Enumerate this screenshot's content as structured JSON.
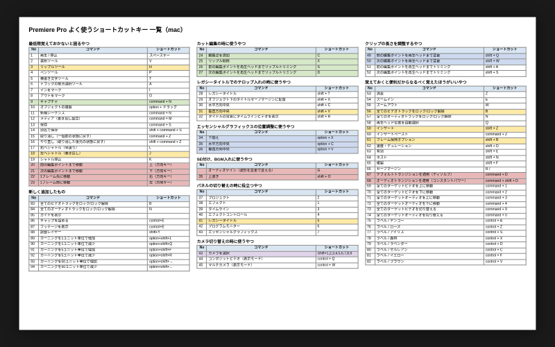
{
  "doc_title": "Premiere Pro よく使うショートカットキー 一覧（mac）",
  "headers": {
    "no": "No",
    "cmd": "コマンド",
    "key": "ショートカット"
  },
  "col1": {
    "sec_a": "最低限覚えておかないと困るやつ",
    "rows_a": [
      {
        "n": 1,
        "c": "再生 / 停止",
        "k": "スペースキー"
      },
      {
        "n": 2,
        "c": "選択ツール",
        "k": "V"
      },
      {
        "n": 3,
        "c": "リップルツール",
        "k": "H",
        "hl": "y"
      },
      {
        "n": 4,
        "c": "ペンツール",
        "k": "P"
      },
      {
        "n": 5,
        "c": "横書き文字ツール",
        "k": "T"
      },
      {
        "n": 6,
        "c": "トラックの前方選択ツール",
        "k": "A"
      },
      {
        "n": 7,
        "c": "インをマーク",
        "k": "I"
      },
      {
        "n": 8,
        "c": "アウトをマーク",
        "k": "O"
      },
      {
        "n": 9,
        "c": "キャプチャ",
        "k": "command + N",
        "hl": "g"
      },
      {
        "n": 10,
        "c": "オブジェクトの複製",
        "k": "option + ドラッグ"
      },
      {
        "n": 11,
        "c": "新規シーケンス",
        "k": "command + N"
      },
      {
        "n": 12,
        "c": "メディア（書き出し設定）",
        "k": "command + M"
      },
      {
        "n": 13,
        "c": "保存",
        "k": "command + S"
      },
      {
        "n": 14,
        "c": "別名で保存",
        "k": "shift + command + S"
      },
      {
        "n": 15,
        "c": "取り消し（一個前の状態に戻す）",
        "k": "command + Z"
      },
      {
        "n": 16,
        "c": "やり直し（取り消した後元の状態に戻す）",
        "k": "shift + command + Z"
      },
      {
        "n": 17,
        "c": "右へシャトル（早送り）",
        "k": "L"
      },
      {
        "n": 18,
        "c": "左へシャトル（巻き戻し）",
        "k": "J",
        "hl": "y"
      },
      {
        "n": 19,
        "c": "シャトル停止",
        "k": "K"
      },
      {
        "n": 20,
        "c": "前の編集ポイントまで移動",
        "k": "上（方向キー）",
        "hl": "r"
      },
      {
        "n": 21,
        "c": "次の編集ポイントまで移動",
        "k": "下（方向キー）",
        "hl": "r"
      },
      {
        "n": 22,
        "c": "1フレーム先に移動",
        "k": "右（方向キー）",
        "hl": "r"
      },
      {
        "n": 23,
        "c": "1フレーム前に移動",
        "k": "左（方向キー）",
        "hl": "r"
      }
    ],
    "sec_b": "新しく追加したもの",
    "rows_b": [
      {
        "n": 83,
        "c": "全てのビデオトラックをロック/ロック解除",
        "k": "B"
      },
      {
        "n": 84,
        "c": "全てのオーディオトラックをロック/ロック解除",
        "k": "N"
      },
      {
        "n": 85,
        "c": "ガイドを表示",
        "k": ""
      },
      {
        "n": 86,
        "c": "ギャップを詰める",
        "k": "control+E"
      },
      {
        "n": 87,
        "c": "フッテージを表示",
        "k": "control+E"
      },
      {
        "n": 88,
        "c": "調整レイヤー",
        "k": "shift+Y"
      },
      {
        "n": 89,
        "c": "カーニングを1ユニット単位で増加",
        "k": "option+shift+1"
      },
      {
        "n": 90,
        "c": "カーニングを1ユニット単位で減少",
        "k": "option+shift+Q"
      },
      {
        "n": 91,
        "c": "カーニングを5ユニット単位で増加",
        "k": "option+shift+F"
      },
      {
        "n": 92,
        "c": "カーニングを5ユニット単位で減少",
        "k": "option+shift+R"
      },
      {
        "n": 93,
        "c": "カーニングを50ユニット単位で増加",
        "k": "option+shift+→"
      },
      {
        "n": 94,
        "c": "カーニングを50ユニット単位で減少",
        "k": "option+shift+←"
      }
    ]
  },
  "col2": {
    "sec_a": "カット編集の時に使うやつ",
    "rows_a": [
      {
        "n": 24,
        "c": "編集点を追加",
        "k": "C",
        "hl": "g"
      },
      {
        "n": 25,
        "c": "リップル削除",
        "k": "X",
        "hl": "g"
      },
      {
        "n": 26,
        "c": "前の編集ポイントを再生ヘッドまでリップルトリミング",
        "k": "S",
        "hl": "g"
      },
      {
        "n": 27,
        "c": "次の編集ポイントを再生ヘッドまでリップルトリミング",
        "k": "D",
        "hl": "g"
      }
    ],
    "sec_b": "レガシータイトルでのテロップ入れの時に使うやつ",
    "rows_b": [
      {
        "n": 28,
        "c": "レガシータイトル",
        "k": "shift + T"
      },
      {
        "n": 29,
        "c": "オブジェクト下のタイトルセーフマージンに配置",
        "k": "shift + X"
      },
      {
        "n": 30,
        "c": "水平方向中央",
        "k": "shift + C"
      },
      {
        "n": 31,
        "c": "垂直方向中央",
        "k": "shift + V",
        "hl": "y"
      },
      {
        "n": 32,
        "c": "タイトルの背景にタイムラインビデオを表示",
        "k": "shift + R"
      }
    ],
    "sec_c": "エッセンシャルグラフィックスの位置調整に使うやつ",
    "rows_c": [
      {
        "n": 34,
        "c": "下揃え",
        "k": "option + X",
        "hl": "b"
      },
      {
        "n": 35,
        "c": "水平方向中央",
        "k": "option + C",
        "hl": "b"
      },
      {
        "n": 36,
        "c": "垂直方向中央",
        "k": "option + V",
        "hl": "b"
      }
    ],
    "sec_d": "SE付け、BGM入れに使うやつ",
    "rows_d": [
      {
        "n": "",
        "c": "オーディオゲイン（波形を変更で変える）",
        "k": "G",
        "hl": "r"
      },
      {
        "n": 35,
        "c": "上書き",
        "k": "shift + O",
        "hl": "r"
      }
    ],
    "sec_e": "パネルの切り替えの時に役立つやつ",
    "rows_e": [
      {
        "n": 37,
        "c": "プロジェクト",
        "k": "2"
      },
      {
        "n": 38,
        "c": "エフェクト",
        "k": "1"
      },
      {
        "n": 39,
        "c": "タイムライン",
        "k": "3"
      },
      {
        "n": 40,
        "c": "エフェクトコントロール",
        "k": "4"
      },
      {
        "n": 41,
        "c": "レガシータイトル",
        "k": "5",
        "hl": "y"
      },
      {
        "n": 42,
        "c": "プログラムモニター",
        "k": "6"
      },
      {
        "n": 43,
        "c": "エッセンシャルグラフィックス",
        "k": "7"
      }
    ],
    "sec_f": "カメラ切り替えの時に使うやつ",
    "rows_f": [
      {
        "n": 43,
        "c": "カメラを選択",
        "k": "Shift+1,2,3,4,5,6,7,8,9",
        "hl": "p"
      },
      {
        "n": 44,
        "c": "コンポジットビデオ（表示モード）",
        "k": "control + Q"
      },
      {
        "n": 45,
        "c": "マルチカメラ（表示モード）",
        "k": "control + W"
      }
    ]
  },
  "col3": {
    "sec_a": "クリップの長さを調整するやつ",
    "rows_a": [
      {
        "n": 49,
        "c": "前の編集ポイントを再生ヘッドまで変更",
        "k": "shift + Q",
        "hl": "b"
      },
      {
        "n": 50,
        "c": "次の編集ポイントを再生ヘッドまで変更",
        "k": "shift + W",
        "hl": "b"
      },
      {
        "n": 51,
        "c": "前の編集ポイントを再生ヘッドまでトリミング",
        "k": "shift + A"
      },
      {
        "n": 52,
        "c": "次の編集ポイントを再生ヘッドまでトリミング",
        "k": "shift + S"
      }
    ],
    "sec_b": "覚えておくと便利だからなるべく覚えたほうがいいやつ",
    "rows_b": [
      {
        "n": 53,
        "c": "消去",
        "k": "Z"
      },
      {
        "n": 54,
        "c": "ズームイン",
        "k": "E"
      },
      {
        "n": 55,
        "c": "ズームアウト",
        "k": "W"
      },
      {
        "n": 56,
        "c": "全てのビデオトラックをロック/ロック解除",
        "k": "B",
        "hl": "y"
      },
      {
        "n": 57,
        "c": "全てのオーディオトラックをロック/ロック解除",
        "k": "N"
      },
      {
        "n": 58,
        "c": "再生ヘッド位置を自動選択",
        "k": "Q"
      },
      {
        "n": 59,
        "c": "インサート",
        "k": "shift + Z",
        "hl": "y"
      },
      {
        "n": 60,
        "c": "インサートペースト",
        "k": "command + Z"
      },
      {
        "n": 61,
        "c": "フレーム保持オプション",
        "k": "shift + B",
        "hl": "y"
      },
      {
        "n": 62,
        "c": "速度・デュレーション",
        "k": "shift + D"
      },
      {
        "n": 63,
        "c": "有効",
        "k": "shift + E"
      },
      {
        "n": 64,
        "c": "ネスト",
        "k": "shift + N"
      },
      {
        "n": 65,
        "c": "複製",
        "k": "shift + F"
      },
      {
        "n": 66,
        "c": "セーフマージン",
        "k": "R /"
      },
      {
        "n": 67,
        "c": "デフォルトトランジションを適用（ディゾルブ）",
        "k": "command + D",
        "hl": "r"
      },
      {
        "n": 68,
        "c": "オーディオトランジションを適用（コンスタントパワー）",
        "k": "command + shift + D",
        "hl": "r"
      },
      {
        "n": 69,
        "c": "全てのターゲットビデオを上に移動",
        "k": "command + 1"
      },
      {
        "n": 70,
        "c": "全てのターゲットビデオを下に移動",
        "k": "command + 2"
      },
      {
        "n": 71,
        "c": "全てのターゲットオーディオを上に移動",
        "k": "command + 3"
      },
      {
        "n": 72,
        "c": "全てのターゲットオーディオを下に移動",
        "k": "command + 4"
      },
      {
        "n": 73,
        "c": "全てのターゲットビデオを切り替える",
        "k": "command + 9"
      },
      {
        "n": 74,
        "c": "全てのターゲットオーディオを切り替える",
        "k": "command + 0"
      },
      {
        "n": 75,
        "c": "ラベル / ヤンゴー",
        "k": "control + A"
      },
      {
        "n": 76,
        "c": "ラベル / ローズ",
        "k": "control + Z"
      },
      {
        "n": 77,
        "c": "ラベル / アイリス",
        "k": "control + S"
      },
      {
        "n": 78,
        "c": "ラベル / 森林",
        "k": "control + X"
      },
      {
        "n": 79,
        "c": "ラベル / ラベンダー",
        "k": "control + D"
      },
      {
        "n": 80,
        "c": "ラベル / セルレアン",
        "k": "control + C"
      },
      {
        "n": 81,
        "c": "ラベル / イエロー",
        "k": "control + F"
      },
      {
        "n": 82,
        "c": "ラベル / ブラウン",
        "k": "control + V"
      }
    ]
  }
}
